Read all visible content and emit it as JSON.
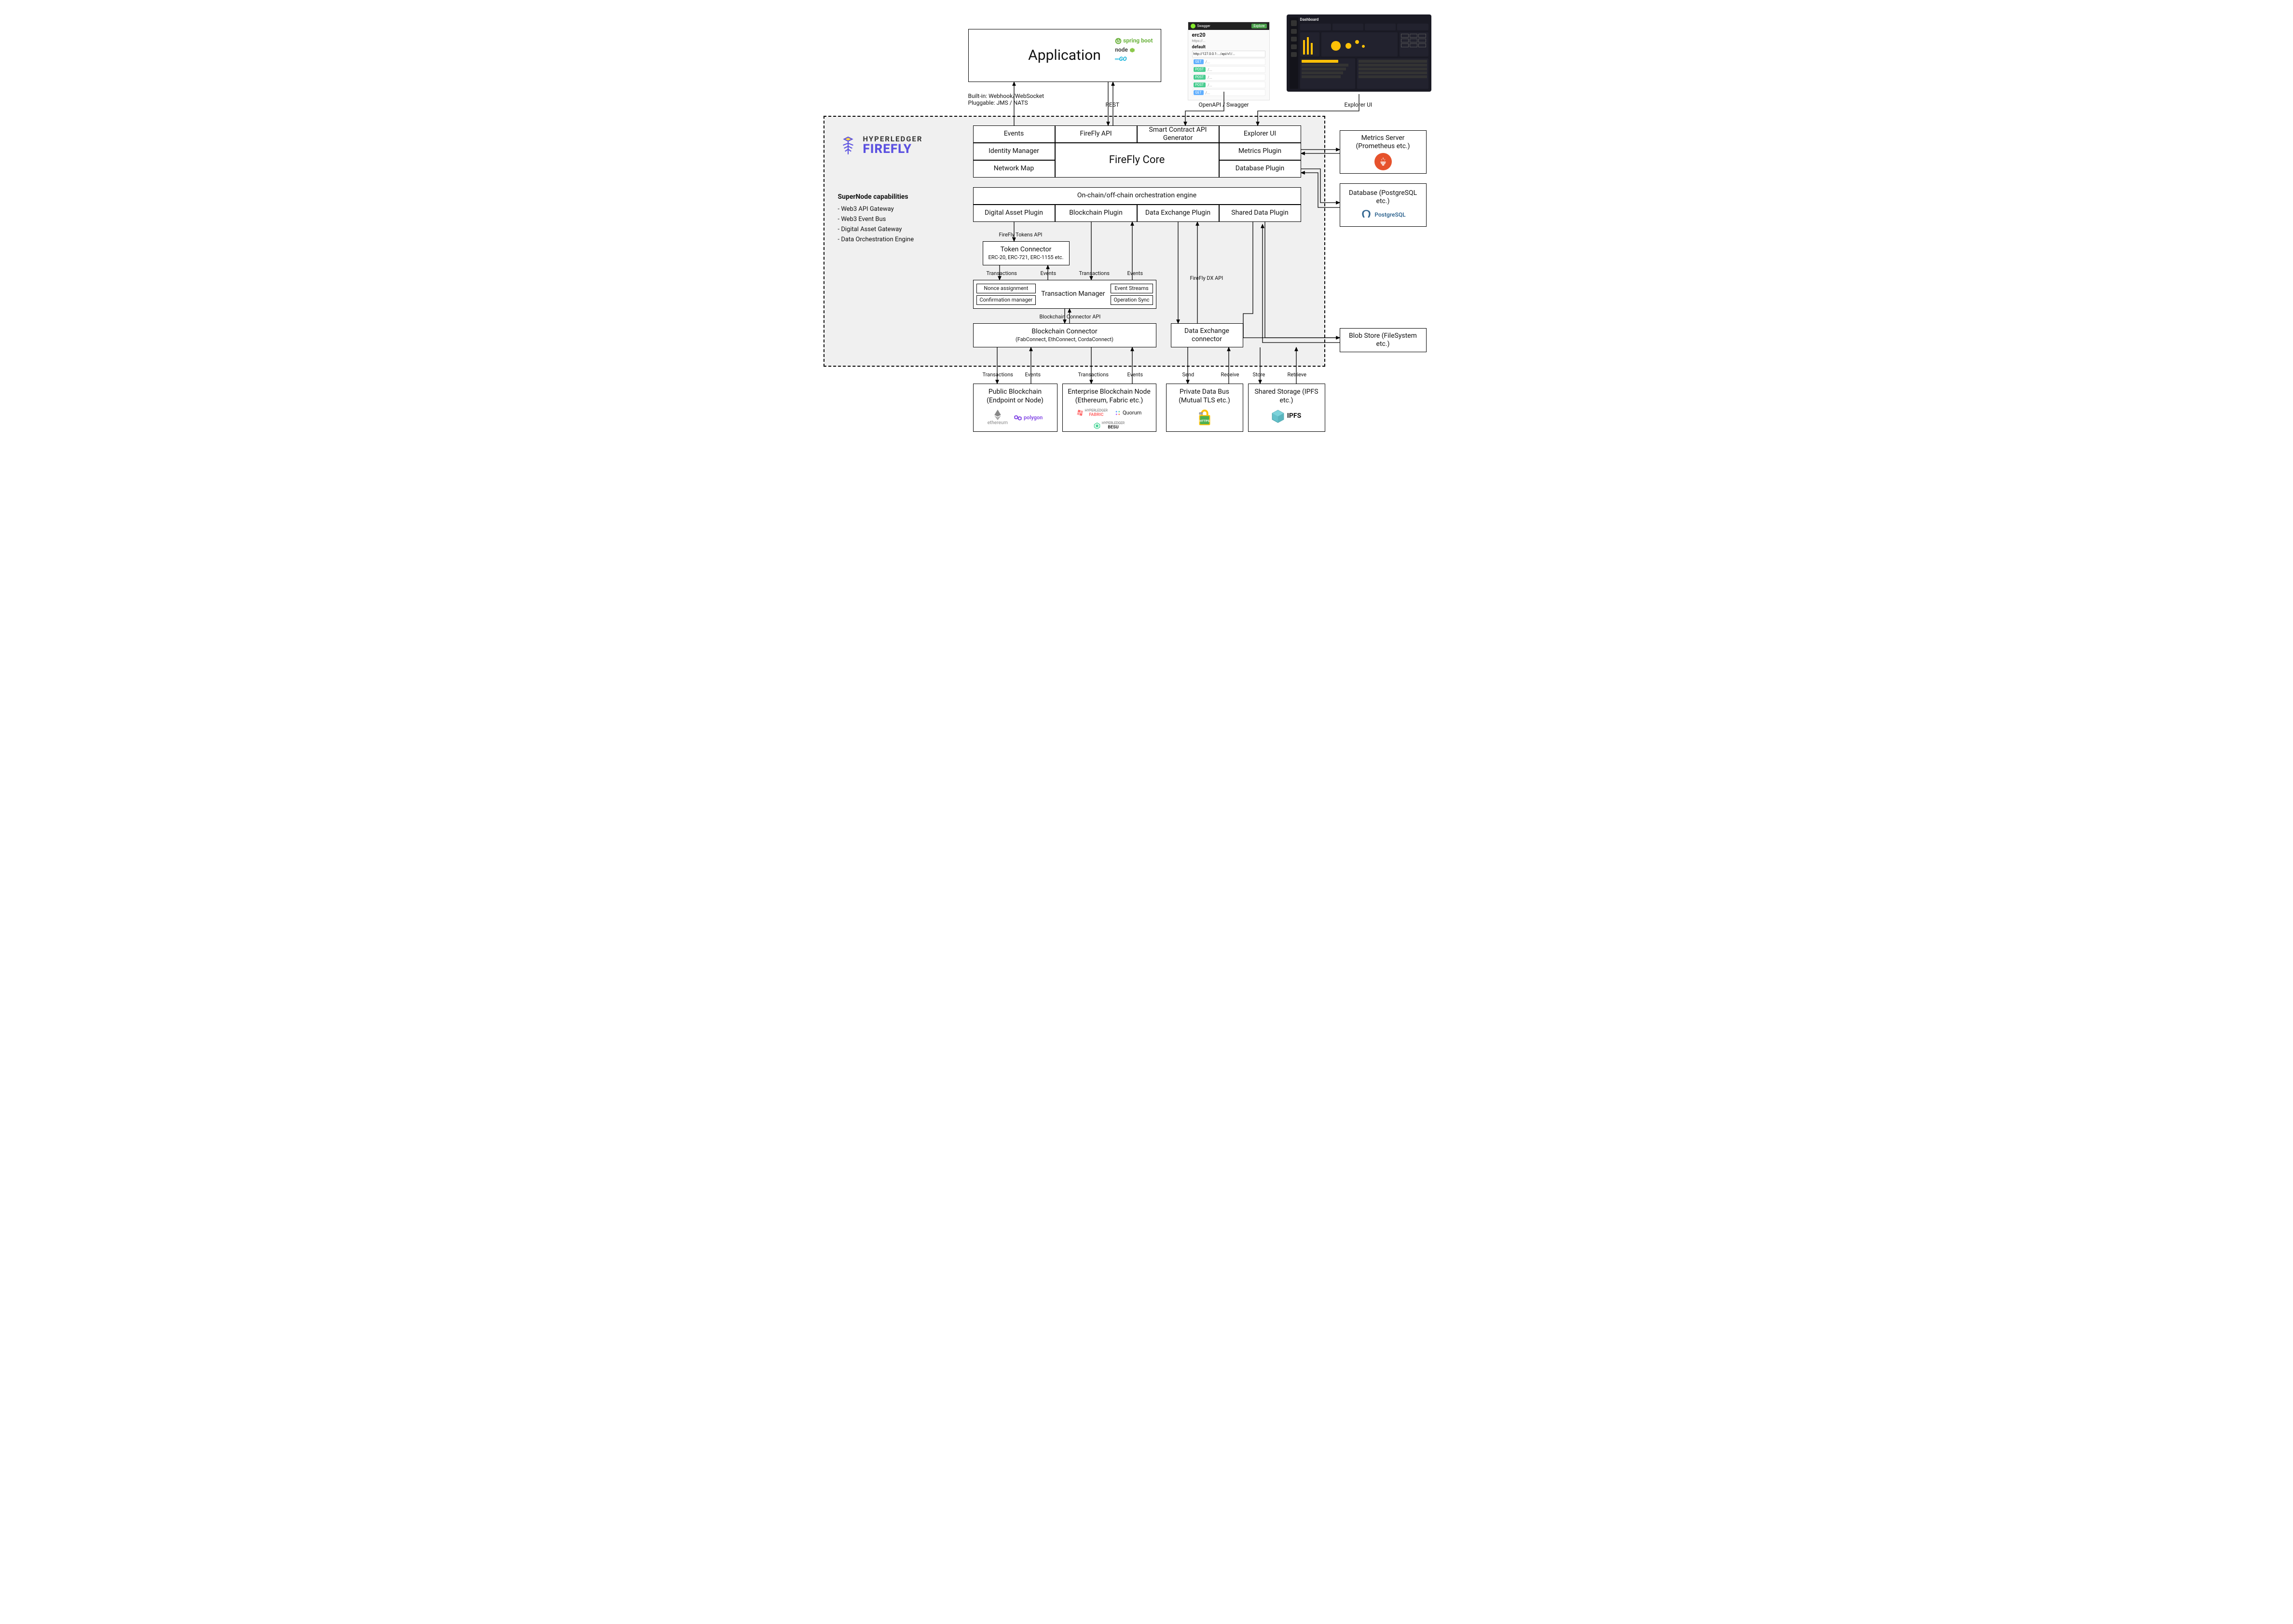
{
  "top": {
    "application": "Application",
    "app_logos": {
      "spring": "spring boot",
      "node": "node",
      "go": "GO"
    },
    "builtin": "Built-in: Webhook/WebSocket",
    "pluggable": "Pluggable: JMS / NATS",
    "rest": "REST",
    "openapi": "OpenAPI / Swagger",
    "explorer_ui_label": "Explorer UI",
    "swagger": {
      "title": "erc20",
      "section": "default"
    }
  },
  "logo": {
    "line1": "HYPERLEDGER",
    "line2": "FIREFLY"
  },
  "capabilities": {
    "title": "SuperNode capabilities",
    "items": [
      "Web3 API Gateway",
      "Web3 Event Bus",
      "Digital Asset Gateway",
      "Data Orchestration Engine"
    ]
  },
  "core": {
    "events": "Events",
    "firefly_api": "FireFly API",
    "sc_api_gen": "Smart Contract API Generator",
    "explorer_ui": "Explorer UI",
    "identity_manager": "Identity Manager",
    "firefly_core": "FireFly Core",
    "metrics_plugin": "Metrics Plugin",
    "network_map": "Network Map",
    "database_plugin": "Database Plugin",
    "orchestration": "On-chain/off-chain orchestration engine",
    "digital_asset_plugin": "Digital Asset Plugin",
    "blockchain_plugin": "Blockchain Plugin",
    "data_exchange_plugin": "Data Exchange Plugin",
    "shared_data_plugin": "Shared Data Plugin"
  },
  "right": {
    "metrics_server": "Metrics Server (Prometheus etc.)",
    "database": "Database (PostgreSQL etc.)",
    "postgres": "PostgreSQL",
    "blob_store": "Blob Store (FileSystem etc.)"
  },
  "mid": {
    "firefly_tokens_api": "FireFly Tokens API",
    "token_connector": "Token Connector",
    "token_connector_sub": "ERC-20, ERC-721, ERC-1155 etc.",
    "transactions": "Transactions",
    "events": "Events",
    "transaction_manager": "Transaction Manager",
    "nonce": "Nonce assignment",
    "confirmation": "Confirmation manager",
    "event_streams": "Event Streams",
    "operation_sync": "Operation Sync",
    "blockchain_connector_api": "Blockchain Connector API",
    "blockchain_connector": "Blockchain Connector",
    "blockchain_connector_sub": "(FabConnect, EthConnect, CordaConnect)",
    "firefly_dx_api": "FireFly DX API",
    "data_exchange_connector": "Data Exchange connector"
  },
  "bottom": {
    "public_blockchain": "Public Blockchain (Endpoint or Node)",
    "enterprise_blockchain": "Enterprise Blockchain Node (Ethereum, Fabric etc.)",
    "private_data_bus": "Private Data Bus (Mutual TLS etc.)",
    "shared_storage": "Shared Storage (IPFS etc.)",
    "send": "Send",
    "receive": "Receive",
    "store": "Store",
    "retrieve": "Retrieve",
    "ethereum": "ethereum",
    "polygon": "polygon",
    "fabric": "HYPERLEDGER FABRIC",
    "quorum": "Quorum",
    "besu": "HYPERLEDGER BESU",
    "ipfs": "IPFS"
  }
}
